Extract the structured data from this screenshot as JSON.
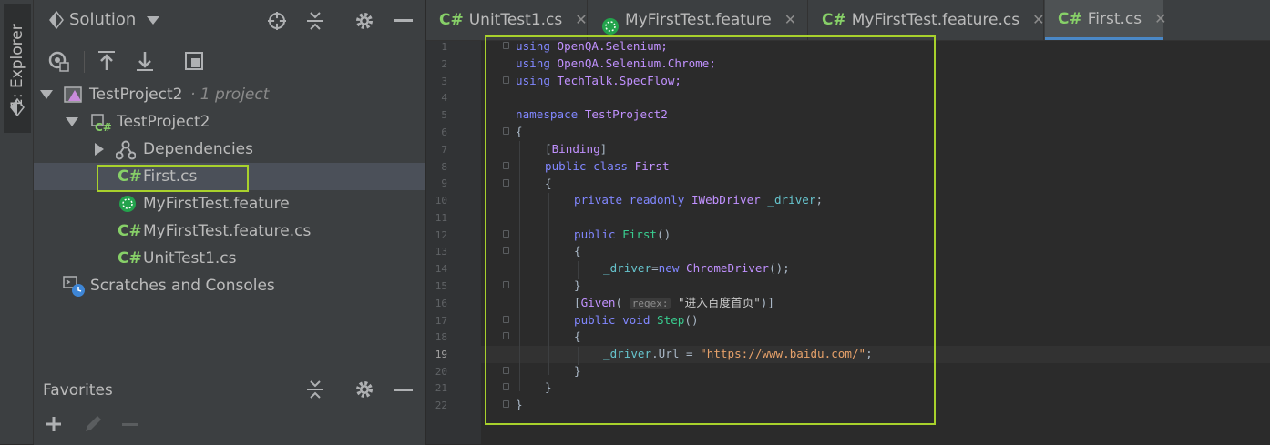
{
  "side_strip": {
    "label": "1: Explorer"
  },
  "explorer": {
    "title": "Solution",
    "tree": [
      {
        "label": "TestProject2",
        "suffix": "· 1 project"
      },
      {
        "label": "TestProject2"
      },
      {
        "label": "Dependencies"
      },
      {
        "label": "First.cs",
        "badge": "C#"
      },
      {
        "label": "MyFirstTest.feature"
      },
      {
        "label": "MyFirstTest.feature.cs",
        "badge": "C#"
      },
      {
        "label": "UnitTest1.cs",
        "badge": "C#"
      },
      {
        "label": "Scratches and Consoles"
      }
    ],
    "favorites": {
      "title": "Favorites"
    }
  },
  "tabs": [
    {
      "badge": "C#",
      "label": "UnitTest1.cs",
      "close": "✕"
    },
    {
      "label": "MyFirstTest.feature",
      "close": "✕"
    },
    {
      "badge": "C#",
      "label": "MyFirstTest.feature.cs",
      "close": "✕"
    },
    {
      "badge": "C#",
      "label": "First.cs",
      "close": "✕"
    }
  ],
  "editor": {
    "line_numbers": [
      "1",
      "2",
      "3",
      "4",
      "5",
      "6",
      "7",
      "8",
      "9",
      "10",
      "11",
      "12",
      "13",
      "14",
      "15",
      "16",
      "17",
      "18",
      "19",
      "20",
      "21",
      "22"
    ],
    "current_line": "19",
    "code": {
      "l1": [
        "using",
        "OpenQA.Selenium;"
      ],
      "l2": [
        "using",
        "OpenQA.Selenium.Chrome;"
      ],
      "l3": [
        "using",
        "TechTalk.SpecFlow;"
      ],
      "l5": [
        "namespace",
        "TestProject2"
      ],
      "l6": "{",
      "l7": [
        "[",
        "Binding",
        "]"
      ],
      "l8": [
        "public",
        "class",
        "First"
      ],
      "l9": "{",
      "l10": [
        "private",
        "readonly",
        "IWebDriver",
        "_driver",
        ";"
      ],
      "l12": [
        "public",
        "First",
        "()"
      ],
      "l13": "{",
      "l14": [
        "_driver",
        "=",
        "new",
        "ChromeDriver",
        "();"
      ],
      "l15": "}",
      "l16": [
        "[",
        "Given",
        "(",
        "regex:",
        "\"进入百度首页\"",
        ")]"
      ],
      "l17": [
        "public",
        "void",
        "Step",
        "()"
      ],
      "l18": "{",
      "l19": [
        "_driver",
        ".Url = ",
        "\"https://www.baidu.com/\"",
        ";"
      ],
      "l20": "}",
      "l21": "}",
      "l22": "}"
    }
  },
  "colors": {
    "highlight_box": "#a8d12c",
    "csharp_badge": "#87d068",
    "active_tab_accent": "#4a88c7"
  }
}
